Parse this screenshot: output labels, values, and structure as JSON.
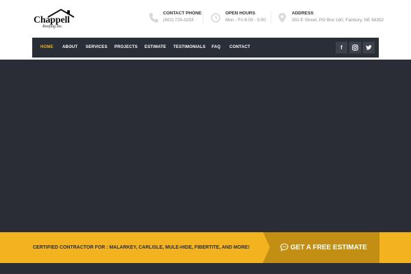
{
  "brand": {
    "name": "Chappell",
    "subtitle": "Roofing Inc."
  },
  "contact": [
    {
      "icon": "phone-icon",
      "label": "CONTACT PHONE",
      "value": "(402) 729-3233"
    },
    {
      "icon": "clock-icon",
      "label": "OPEN HOURS",
      "value": "Mon - Fri 8:00 - 5:00"
    },
    {
      "icon": "map-pin-icon",
      "label": "ADDRESS",
      "value": "302 E Street, PO Box 160, Fairbury, NE 68352"
    }
  ],
  "nav": {
    "items": [
      "HOME",
      "ABOUT",
      "SERVICES",
      "PROJECTS",
      "ESTIMATE",
      "TESTIMONIALS",
      "FAQ",
      "CONTACT"
    ],
    "active": "HOME"
  },
  "social": [
    {
      "icon": "facebook-icon",
      "glyph": "f"
    },
    {
      "icon": "instagram-icon",
      "glyph": ""
    },
    {
      "icon": "twitter-icon",
      "glyph": ""
    }
  ],
  "banner": {
    "text": "CERTIFIED CONTRACTOR FOR : MALARKEY, CARLISLE, MULE-HIDE, FIBERTITE, AND MORE!",
    "cta_label": "GET A FREE ESTIMATE",
    "cta_icon": "chat-bubble-icon"
  },
  "colors": {
    "accent": "#f3b321",
    "accent_dark": "#c28f14",
    "dark": "#2a2d36",
    "nav_bg": "#2a2e36",
    "active_nav": "#f2b21b"
  }
}
